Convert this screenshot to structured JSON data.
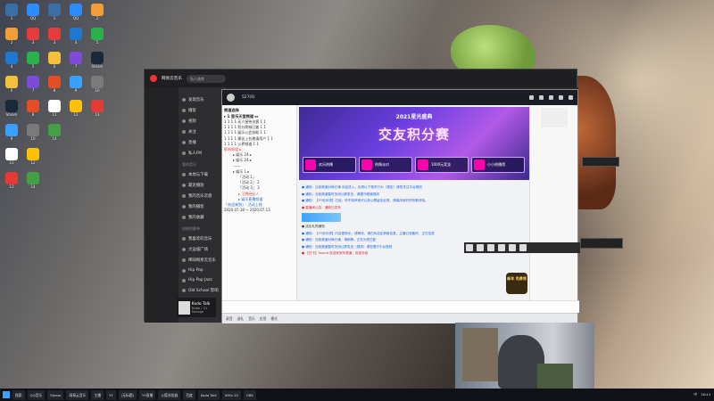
{
  "desktop": {
    "icons": [
      {
        "label": "1",
        "color": "#3a6ea5"
      },
      {
        "label": "QQ",
        "color": "#2b8cff"
      },
      {
        "label": "2",
        "color": "#f29d38"
      },
      {
        "label": "3",
        "color": "#e63b3b"
      },
      {
        "label": "4",
        "color": "#1f77d0"
      },
      {
        "label": "5",
        "color": "#2bb14b"
      },
      {
        "label": "6",
        "color": "#f2c13b"
      },
      {
        "label": "7",
        "color": "#7d4bd8"
      },
      {
        "label": "Steam",
        "color": "#1b2838"
      },
      {
        "label": "8",
        "color": "#e44d26"
      },
      {
        "label": "9",
        "color": "#3aa0ff"
      },
      {
        "label": "10",
        "color": "#7a7a7a"
      },
      {
        "label": "11",
        "color": "#ffffff"
      },
      {
        "label": "12",
        "color": "#ffc107"
      },
      {
        "label": "13",
        "color": "#e53935"
      },
      {
        "label": "14",
        "color": "#43a047"
      }
    ]
  },
  "music": {
    "app_title": "网易云音乐",
    "search_placeholder": "私人曲库",
    "user": "",
    "nav_title": "",
    "nav": [
      {
        "label": "发现音乐"
      },
      {
        "label": "播客"
      },
      {
        "label": "视频"
      },
      {
        "label": "关注"
      },
      {
        "label": "直播"
      },
      {
        "label": "私人FM"
      }
    ],
    "my_music": "我的音乐",
    "my_items": [
      {
        "label": "本地与下载"
      },
      {
        "label": "最近播放"
      },
      {
        "label": "我的音乐云盘"
      },
      {
        "label": "我的播客"
      },
      {
        "label": "我的收藏"
      }
    ],
    "playlists_title": "创建的歌单",
    "playlists": [
      {
        "label": "我喜欢的音乐"
      },
      {
        "label": "大运城广场"
      },
      {
        "label": "稀缺网易云音乐"
      },
      {
        "label": "Hip Pop"
      },
      {
        "label": "Hip Pop Jazz"
      },
      {
        "label": "Old School 影响"
      }
    ],
    "now_playing": {
      "title": "Kodo Talk",
      "artist": "Dabo / 21 Savage"
    }
  },
  "yy": {
    "username": "",
    "hot": "527(6)",
    "left_header": "频道选择",
    "left_rows": [
      {
        "text": "▸ 1 音乐天堂频道 ▸▸",
        "cls": "hdr"
      },
      {
        "text": "1 1 1 1 无人接待访客 1 1",
        "cls": ""
      },
      {
        "text": "1 1 1 1 积分商城已被 1 1",
        "cls": ""
      },
      {
        "text": "1 1 1 1 娱乐公会协助 1 1",
        "cls": ""
      },
      {
        "text": "1 1 1 1 建议上台邀请用户 1 1",
        "cls": ""
      },
      {
        "text": "1 1 1 1 公界频道 1 1",
        "cls": ""
      },
      {
        "text": "影响频道 ▸",
        "cls": "red"
      },
      {
        "text": "▸ 娱乐 24 ▸",
        "cls": "indent"
      },
      {
        "text": "▸ 娱乐 24 ▸",
        "cls": "indent"
      },
      {
        "text": "------",
        "cls": "indent"
      },
      {
        "text": "▸ 娱乐 1 ▸",
        "cls": "indent"
      },
      {
        "text": "「活动 1」",
        "cls": "indent2"
      },
      {
        "text": "「活动 2」 2",
        "cls": "indent2"
      },
      {
        "text": "「活动 3」 3",
        "cls": "indent2"
      },
      {
        "text": "▸ 王牌经纪人",
        "cls": "indent2 red"
      },
      {
        "text": "▸ 娱乐直播频道",
        "cls": "indent2 blue"
      },
      {
        "text": "「欢迎来到」- 活动上线",
        "cls": "blue"
      },
      {
        "text": "2020.07.18 ~ 2020.07.13",
        "cls": ""
      }
    ],
    "banner": {
      "subtitle": "2021星光盛典",
      "title": "交友积分赛",
      "cards": [
        {
          "label": "欢乐热播"
        },
        {
          "label": "热情派对"
        },
        {
          "label": "1000元奖金"
        },
        {
          "label": "小小热播馆"
        }
      ]
    },
    "chat": [
      {
        "text": "● 通知：当前频道对局已满 欢迎进入，出现以下相关行为（规定）请您关注平台规则",
        "cls": "blue"
      },
      {
        "text": "● 通知：当前频道暂时关闭公屏发言，请遵守频道规则",
        "cls": "blue"
      },
      {
        "text": "● 通知：【YY欢乐颂】已经，听不到声音可以到公屏留言反馈，请保持良好的听歌体验。",
        "cls": "blue"
      },
      {
        "text": "● 直播间公告：通知已发布",
        "cls": "sys"
      },
      {
        "text": "gift",
        "cls": "gift"
      },
      {
        "text": "● 送出礼物通知",
        "cls": ""
      },
      {
        "text": "● 通知：【YY欢乐颂】内容更新中，请等待，请在欢迎区获取信息，主播已准备好，正在连麦",
        "cls": "blue"
      },
      {
        "text": "● 通知：当前频道对局已满，请稍等，正在为您匹配",
        "cls": "blue"
      },
      {
        "text": "● 通知：当前频道暂时关闭公屏发言（规则）请您遵守平台规则",
        "cls": "blue"
      },
      {
        "text": "● 【打卡】Sound 欢迎来到本频道，欢迎光临",
        "cls": "sys"
      }
    ],
    "gift_badge": "新年\n免费领",
    "input_placeholder": "",
    "bottom": [
      "录音",
      "送礼",
      "音乐",
      "应用",
      "模式"
    ]
  },
  "subtitle_text": "",
  "taskbar": {
    "items": [
      "搜索",
      "QQ音乐",
      "Steam",
      "网易云音乐",
      "主播",
      "YY",
      "(无标题)",
      "YY直播",
      "火狐浏览器",
      "百度",
      "Kodo Talk",
      "VMix 20",
      "OBS"
    ],
    "tray": [
      "中",
      "16:44"
    ]
  }
}
